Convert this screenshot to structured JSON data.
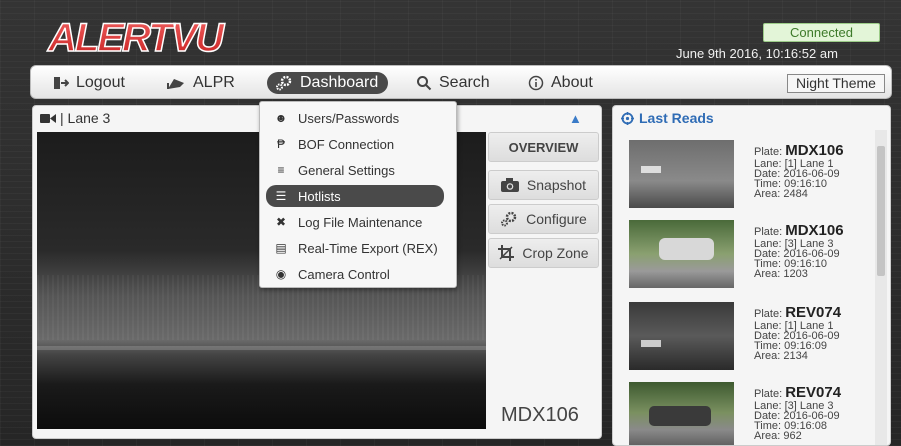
{
  "header": {
    "logo_text": "ALERTVU",
    "status": "Connected",
    "datetime": "June 9th 2016, 10:16:52 am"
  },
  "nav": {
    "logout": "Logout",
    "alpr": "ALPR",
    "dashboard": "Dashboard",
    "search": "Search",
    "about": "About",
    "night_theme": "Night Theme"
  },
  "dropdown": {
    "items": [
      {
        "label": "Users/Passwords",
        "icon": "users-icon"
      },
      {
        "label": "BOF Connection",
        "icon": "bof-icon"
      },
      {
        "label": "General Settings",
        "icon": "sliders-icon"
      },
      {
        "label": "Hotlists",
        "icon": "list-icon"
      },
      {
        "label": "Log File Maintenance",
        "icon": "tools-icon"
      },
      {
        "label": "Real-Time Export (REX)",
        "icon": "document-icon"
      },
      {
        "label": "Camera Control",
        "icon": "camera-control-icon"
      }
    ],
    "active_index": 3
  },
  "camera": {
    "title": "| Lane 3",
    "plate": "MDX106",
    "buttons": {
      "overview": "OVERVIEW",
      "snapshot": "Snapshot",
      "configure": "Configure",
      "crop_zone": "Crop Zone"
    }
  },
  "last_reads": {
    "title": "Last Reads",
    "items": [
      {
        "plate_label": "Plate:",
        "plate": "MDX106",
        "lane": "Lane:  [1] Lane 1",
        "date": "Date:  2016-06-09",
        "time": "Time:  09:16:10",
        "area": "Area:  2484"
      },
      {
        "plate_label": "Plate:",
        "plate": "MDX106",
        "lane": "Lane:  [3] Lane 3",
        "date": "Date:  2016-06-09",
        "time": "Time:  09:16:10",
        "area": "Area:  1203"
      },
      {
        "plate_label": "Plate:",
        "plate": "REV074",
        "lane": "Lane:  [1] Lane 1",
        "date": "Date:  2016-06-09",
        "time": "Time:  09:16:09",
        "area": "Area:  2134"
      },
      {
        "plate_label": "Plate:",
        "plate": "REV074",
        "lane": "Lane:  [3] Lane 3",
        "date": "Date:  2016-06-09",
        "time": "Time:  09:16:08",
        "area": "Area:  962"
      }
    ]
  },
  "colors": {
    "accent": "#2f6cb5",
    "logo_red": "#e23b3b",
    "connected_bg": "#e3f5d8",
    "active_pill": "#4a4a4a"
  }
}
